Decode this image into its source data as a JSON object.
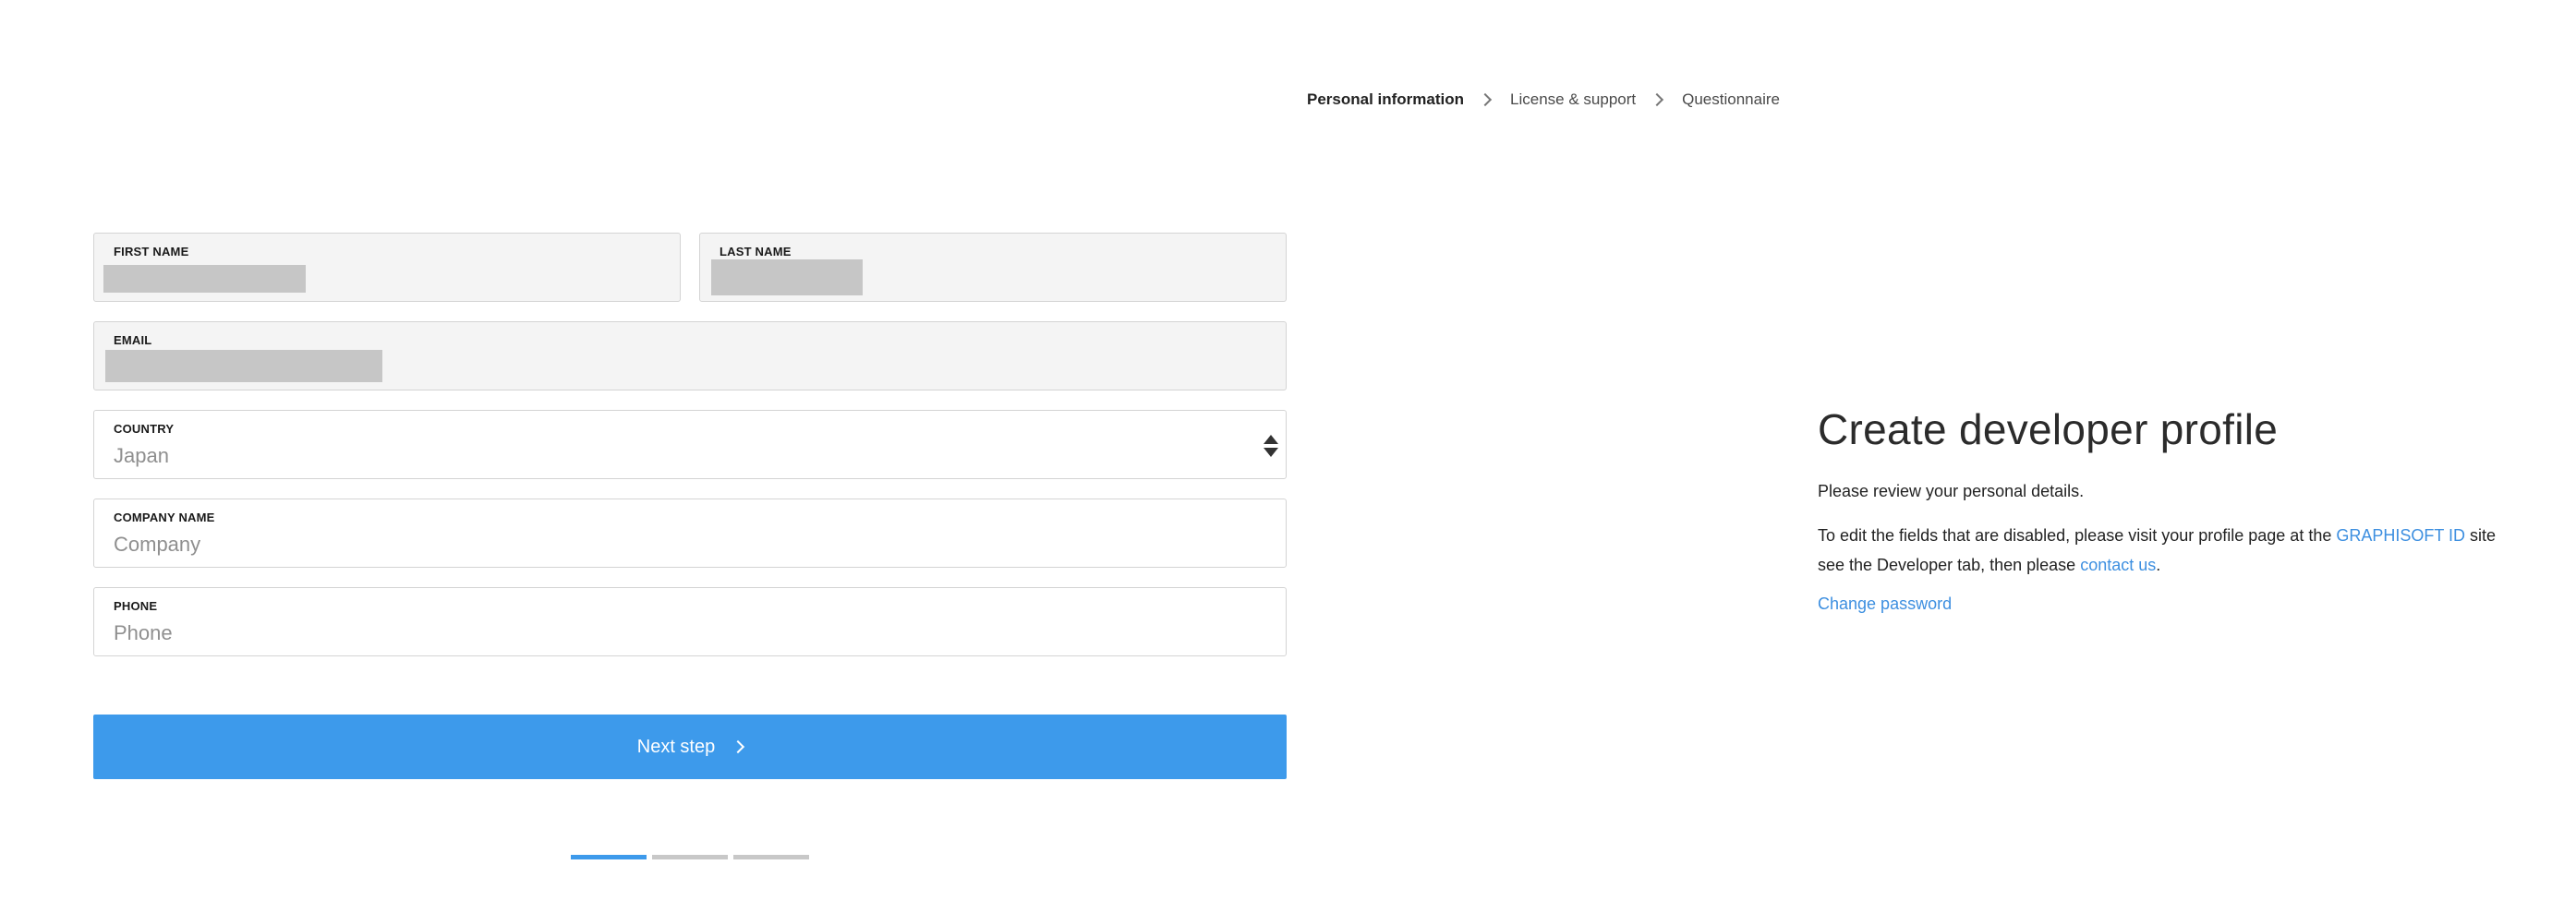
{
  "breadcrumb": {
    "step1": "Personal information",
    "step2": "License & support",
    "step3": "Questionnaire"
  },
  "form": {
    "first_name": {
      "label": "FIRST NAME",
      "value": ""
    },
    "last_name": {
      "label": "LAST NAME",
      "value": ""
    },
    "email": {
      "label": "EMAIL",
      "value": ""
    },
    "country": {
      "label": "COUNTRY",
      "value": "Japan"
    },
    "company": {
      "label": "COMPANY NAME",
      "placeholder": "Company"
    },
    "phone": {
      "label": "PHONE",
      "placeholder": "Phone"
    },
    "next_label": "Next step"
  },
  "progress": {
    "current_step": 1,
    "total_steps": 3
  },
  "info": {
    "title": "Create developer profile",
    "intro": "Please review your personal details.",
    "edit_text_1": "To edit the fields that are disabled, please visit your profile page at the ",
    "graphisoft_link": "GRAPHISOFT ID",
    "edit_text_2": " site",
    "edit_text_3": "see the Developer tab, then please ",
    "contact_link": "contact us",
    "edit_text_4": ".",
    "change_password": "Change password"
  },
  "colors": {
    "accent": "#3d9aeb",
    "link": "#3d8fe0",
    "disabled_bg": "#f4f4f4",
    "redaction": "#c6c6c6"
  },
  "icons": {
    "breadcrumb_separator": "chevron-right-icon",
    "select": "select-arrows-icon",
    "next": "chevron-right-icon"
  }
}
